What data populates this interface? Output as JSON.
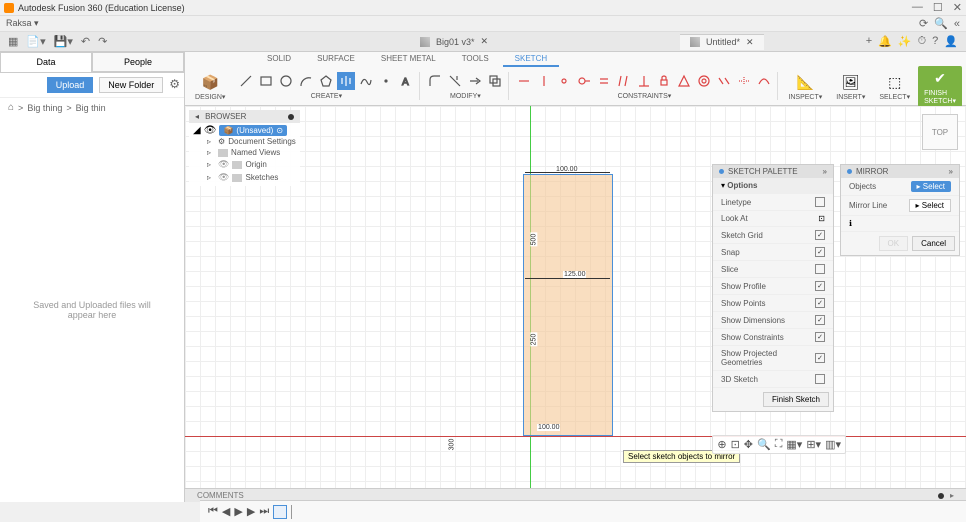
{
  "app": {
    "title": "Autodesk Fusion 360 (Education License)"
  },
  "user": {
    "name": "Raksa"
  },
  "tabs": [
    {
      "label": "Big01 v3*",
      "active": false
    },
    {
      "label": "Untitled*",
      "active": true
    }
  ],
  "leftPanel": {
    "dataTab": "Data",
    "peopleTab": "People",
    "uploadBtn": "Upload",
    "newFolderBtn": "New Folder",
    "breadcrumb": [
      "Big thing",
      "Big thin"
    ],
    "placeholder": "Saved and Uploaded files will appear here"
  },
  "ribbon": {
    "designBtn": "DESIGN",
    "tabs": [
      "SOLID",
      "SURFACE",
      "SHEET METAL",
      "TOOLS",
      "SKETCH"
    ],
    "activeTab": 4,
    "groups": {
      "create": "CREATE",
      "modify": "MODIFY",
      "constraints": "CONSTRAINTS",
      "inspect": "INSPECT",
      "insert": "INSERT",
      "select": "SELECT",
      "finish": "FINISH SKETCH"
    }
  },
  "browser": {
    "header": "BROWSER",
    "root": "(Unsaved)",
    "nodes": [
      "Document Settings",
      "Named Views",
      "Origin",
      "Sketches"
    ]
  },
  "dimensions": {
    "top": "100.00",
    "mid": "125.00",
    "left1": "500",
    "left2": "250",
    "bottom": "100.00",
    "leftOut": "300"
  },
  "viewcube": {
    "label": "TOP"
  },
  "tooltip": "Select sketch objects to mirror",
  "sketchPalette": {
    "title": "SKETCH PALETTE",
    "section": "Options",
    "rows": [
      {
        "label": "Linetype",
        "checked": false
      },
      {
        "label": "Look At",
        "checked": false,
        "icon": true
      },
      {
        "label": "Sketch Grid",
        "checked": true
      },
      {
        "label": "Snap",
        "checked": true
      },
      {
        "label": "Slice",
        "checked": false
      },
      {
        "label": "Show Profile",
        "checked": true
      },
      {
        "label": "Show Points",
        "checked": true
      },
      {
        "label": "Show Dimensions",
        "checked": true
      },
      {
        "label": "Show Constraints",
        "checked": true
      },
      {
        "label": "Show Projected Geometries",
        "checked": true
      },
      {
        "label": "3D Sketch",
        "checked": false
      }
    ],
    "finishBtn": "Finish Sketch"
  },
  "mirrorPalette": {
    "title": "MIRROR",
    "objects": "Objects",
    "mirrorLine": "Mirror Line",
    "selectBtn": "Select",
    "okBtn": "OK",
    "cancelBtn": "Cancel"
  },
  "comments": {
    "label": "COMMENTS"
  }
}
